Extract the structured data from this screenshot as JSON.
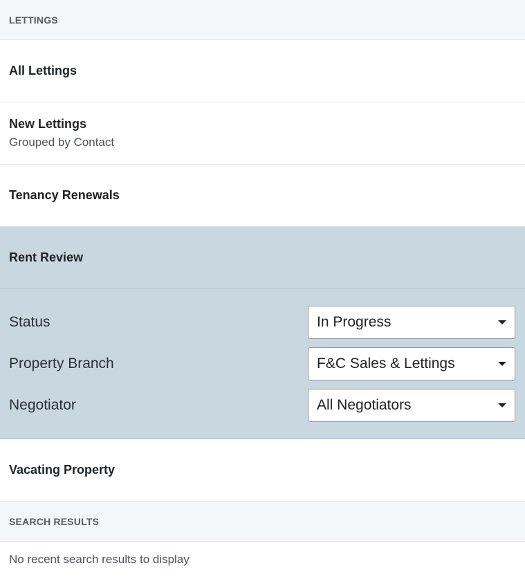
{
  "lettings_header": "LETTINGS",
  "nav": {
    "all_lettings": "All Lettings",
    "new_lettings": "New Lettings",
    "new_lettings_subtitle": "Grouped by Contact",
    "tenancy_renewals": "Tenancy Renewals",
    "rent_review": "Rent Review",
    "vacating_property": "Vacating Property"
  },
  "filters": {
    "status_label": "Status",
    "status_value": "In Progress",
    "branch_label": "Property Branch",
    "branch_value": "F&C Sales & Lettings",
    "negotiator_label": "Negotiator",
    "negotiator_value": "All Negotiators"
  },
  "search_results_header": "SEARCH RESULTS",
  "search_results_empty": "No recent search results to display",
  "colors": {
    "active_bg": "#c9d7e0",
    "header_bg": "#f4f7f8"
  },
  "icons": {
    "dropdown": "chevron-down-icon"
  }
}
